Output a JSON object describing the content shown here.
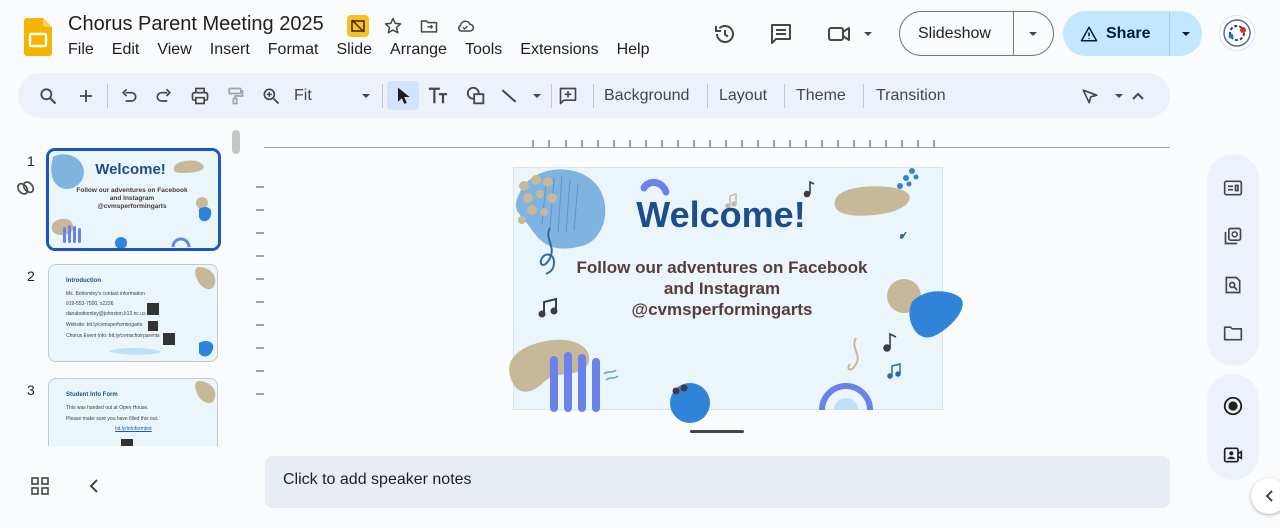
{
  "document": {
    "title": "Chorus Parent Meeting 2025"
  },
  "menu": [
    "File",
    "Edit",
    "View",
    "Insert",
    "Format",
    "Slide",
    "Arrange",
    "Tools",
    "Extensions",
    "Help"
  ],
  "header": {
    "slideshow_label": "Slideshow",
    "share_label": "Share"
  },
  "toolbar": {
    "zoom_value": "Fit",
    "background_label": "Background",
    "layout_label": "Layout",
    "theme_label": "Theme",
    "transition_label": "Transition"
  },
  "filmstrip": {
    "slides": [
      {
        "number": "1",
        "title": "Welcome!",
        "lines": [
          "Follow our adventures on Facebook",
          "and Instagram",
          "@cvmsperformingarts"
        ]
      },
      {
        "number": "2",
        "title": "Introduction",
        "lines": [
          "Ms. Bottomley's contact information",
          "919-553-7500, x2226",
          "danabottomley@johnston.k12.nc.us",
          "Website: bit.ly/cvmsperformingarts",
          "Chorus Event Info: bit.ly/cvmschoirparents"
        ]
      },
      {
        "number": "3",
        "title": "Student Info Form",
        "lines": [
          "This was handed out at Open House.",
          "Please make sure you have filled this out.",
          "bit.ly/infoformbot"
        ]
      }
    ]
  },
  "slide": {
    "title": "Welcome!",
    "body_lines": [
      "Follow our adventures on Facebook",
      "and Instagram",
      "@cvmsperformingarts"
    ]
  },
  "notes": {
    "placeholder": "Click to add speaker notes"
  },
  "colors": {
    "accent": "#1a56c4",
    "share_bg": "#c2e7ff",
    "toolbar_bg": "#edf2fa",
    "slide_title": "#1e4d8c"
  }
}
